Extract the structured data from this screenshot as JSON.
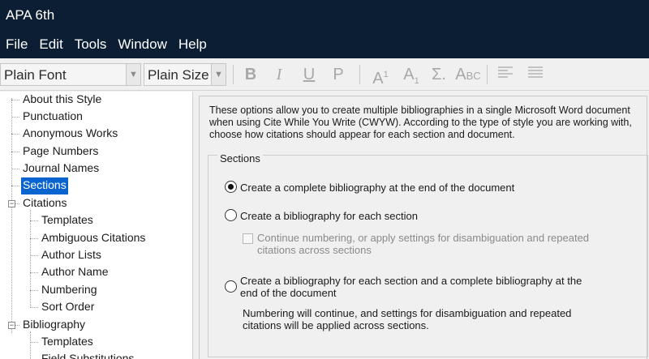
{
  "window": {
    "title": "APA 6th"
  },
  "menu": [
    "File",
    "Edit",
    "Tools",
    "Window",
    "Help"
  ],
  "toolbar": {
    "font": "Plain Font",
    "size": "Plain Size",
    "bold": "B",
    "italic": "I",
    "underline": "U",
    "plain": "P",
    "superscript": "A",
    "superscript_mark": "1",
    "subscript": "A",
    "subscript_mark": "1",
    "symbol": "Σ.",
    "smallcaps_a": "A",
    "smallcaps_bc": "BC"
  },
  "tree": {
    "items": [
      {
        "label": "About this Style"
      },
      {
        "label": "Punctuation"
      },
      {
        "label": "Anonymous Works"
      },
      {
        "label": "Page Numbers"
      },
      {
        "label": "Journal Names"
      },
      {
        "label": "Sections",
        "selected": true
      },
      {
        "label": "Citations",
        "expanded": true
      },
      {
        "label": "Templates"
      },
      {
        "label": "Ambiguous Citations"
      },
      {
        "label": "Author Lists"
      },
      {
        "label": "Author Name"
      },
      {
        "label": "Numbering"
      },
      {
        "label": "Sort Order"
      },
      {
        "label": "Bibliography",
        "expanded": true
      },
      {
        "label": "Templates"
      },
      {
        "label": "Field Substitutions"
      }
    ]
  },
  "panel": {
    "intro": "These options allow you to create multiple bibliographies in a single Microsoft Word document when using Cite While You Write (CWYW). According to the type of style you are working with, choose how citations should appear for each section and document.",
    "group_label": "Sections",
    "options": {
      "complete": "Create a complete bibliography at the end of the document",
      "each_section": "Create a bibliography for each section",
      "continue_numbering": "Continue numbering, or apply settings for disambiguation and repeated citations across sections",
      "both": "Create a bibliography for each section and a complete bibliography at the end of the document",
      "both_note": "Numbering will continue, and settings for disambiguation and repeated citations will be applied across sections."
    },
    "selected_option": "complete"
  }
}
